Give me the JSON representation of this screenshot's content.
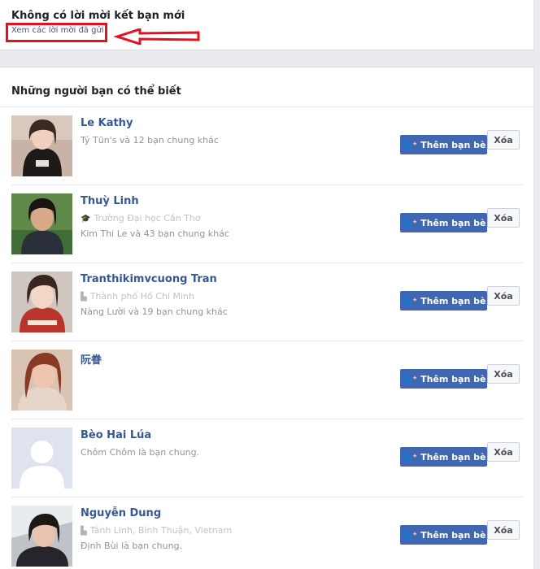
{
  "requests": {
    "title": "Không có lời mời kết bạn mới",
    "sent_link": "Xem các lời mời đã gửi"
  },
  "suggestions": {
    "header": "Những người bạn có thể biết",
    "add_button_label": "Thêm bạn bè",
    "delete_button_label": "Xóa",
    "people": [
      {
        "name": "Le Kathy",
        "info": "",
        "mutual": "Tý Tũn's và 12 bạn chung khác"
      },
      {
        "name": "Thuỳ Linh",
        "info": "Trường Đại học Cần Thơ",
        "mutual": "Kim Thi Le và 43 bạn chung khác"
      },
      {
        "name": "Tranthikimvcuong Tran",
        "info": "Thành phố Hồ Chí Minh",
        "mutual": "Nàng Lười và 19 bạn chung khác"
      },
      {
        "name": "阮眷",
        "info": "",
        "mutual": ""
      },
      {
        "name": "Bèo Hai Lúa",
        "info": "",
        "mutual": "Chôm Chôm là bạn chung."
      },
      {
        "name": "Nguyễn Dung",
        "info": "Tánh Linh, Bình Thuận, Vietnam",
        "mutual": "Định Bùi là bạn chung."
      }
    ]
  },
  "colors": {
    "brand_blue": "#4267b2",
    "link_blue": "#365899",
    "annotation_red": "#e8101c"
  },
  "icons": {
    "add_friend": "add-friend-icon",
    "school": "school-icon",
    "location": "location-icon"
  }
}
